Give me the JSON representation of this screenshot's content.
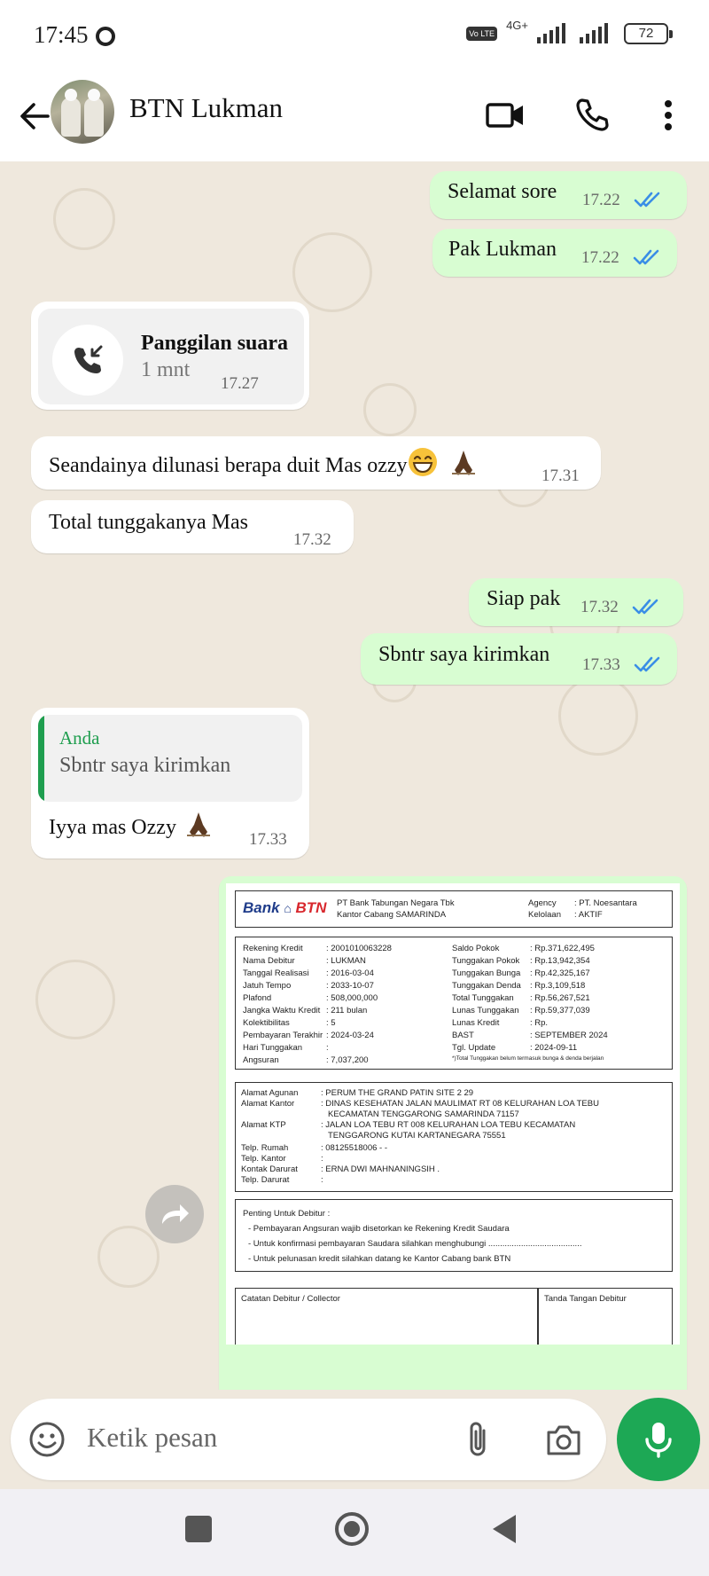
{
  "status_bar": {
    "time": "17:45",
    "network": "4G+",
    "volte": "Vo LTE",
    "battery": "72"
  },
  "header": {
    "contact_name": "BTN Lukman"
  },
  "messages": [
    {
      "id": "m1",
      "direction": "out",
      "text": "Selamat sore",
      "time": "17.22",
      "read": true
    },
    {
      "id": "m2",
      "direction": "out",
      "text": "Pak Lukman",
      "time": "17.22",
      "read": true
    },
    {
      "id": "m3",
      "direction": "in",
      "type": "call",
      "title": "Panggilan suara",
      "duration": "1 mnt",
      "time": "17.27"
    },
    {
      "id": "m4",
      "direction": "in",
      "text": "Seandainya dilunasi berapa duit Mas ozzy",
      "emojis": [
        "grinning-face",
        "folded-hands"
      ],
      "time": "17.31"
    },
    {
      "id": "m5",
      "direction": "in",
      "text": "Total tunggakanya Mas",
      "time": "17.32"
    },
    {
      "id": "m6",
      "direction": "out",
      "text": "Siap pak",
      "time": "17.32",
      "read": true
    },
    {
      "id": "m7",
      "direction": "out",
      "text": "Sbntr saya kirimkan",
      "time": "17.33",
      "read": true
    },
    {
      "id": "m8",
      "direction": "in",
      "quote_author": "Anda",
      "quote_text": "Sbntr saya kirimkan",
      "text": "Iyya mas Ozzy",
      "emojis": [
        "folded-hands"
      ],
      "time": "17.33"
    }
  ],
  "document": {
    "logo_text": "Bank",
    "logo_brand": "BTN",
    "bank_name": "PT Bank Tabungan Negara Tbk",
    "branch": "Kantor Cabang SAMARINDA",
    "agency_label": "Agency",
    "agency_value": ": PT. Noesantara",
    "kelolaan_label": "Kelolaan",
    "kelolaan_value": ": AKTIF",
    "left_fields": [
      {
        "label": "Rekening Kredit",
        "value": ": 2001010063228"
      },
      {
        "label": "Nama Debitur",
        "value": ": LUKMAN"
      },
      {
        "label": "Tanggal Realisasi",
        "value": ": 2016-03-04"
      },
      {
        "label": "Jatuh Tempo",
        "value": ": 2033-10-07"
      },
      {
        "label": "Plafond",
        "value": ": 508,000,000"
      },
      {
        "label": "Jangka Waktu Kredit",
        "value": ": 211 bulan"
      },
      {
        "label": "Kolektibilitas",
        "value": ": 5"
      },
      {
        "label": "Pembayaran Terakhir",
        "value": ": 2024-03-24"
      },
      {
        "label": "Hari Tunggakan",
        "value": ":"
      },
      {
        "label": "Angsuran",
        "value": ": 7,037,200"
      }
    ],
    "right_fields": [
      {
        "label": "Saldo Pokok",
        "value": ": Rp.371,622,495"
      },
      {
        "label": "Tunggakan Pokok",
        "value": ": Rp.13,942,354"
      },
      {
        "label": "Tunggakan Bunga",
        "value": ": Rp.42,325,167"
      },
      {
        "label": "Tunggakan Denda",
        "value": ": Rp.3,109,518"
      },
      {
        "label": "Total Tunggakan",
        "value": ": Rp.56,267,521"
      },
      {
        "label": "Lunas Tunggakan",
        "value": ": Rp.59,377,039"
      },
      {
        "label": "Lunas Kredit",
        "value": ": Rp."
      },
      {
        "label": "BAST",
        "value": ": SEPTEMBER 2024"
      },
      {
        "label": "Tgl. Update",
        "value": ": 2024-09-11"
      }
    ],
    "footnote": "*)Total Tunggakan belum termasuk bunga & denda berjalan",
    "addr_fields": [
      {
        "label": "Alamat Agunan",
        "value": ": PERUM THE GRAND PATIN SITE 2 29"
      },
      {
        "label": "Alamat Kantor",
        "value": ":  DINAS KESEHATAN JALAN MAULIMAT RT 08 KELURAHAN LOA TEBU"
      },
      {
        "label": "",
        "value": "KECAMATAN TENGGARONG SAMARINDA 71157"
      },
      {
        "label": "Alamat KTP",
        "value": ": JALAN LOA TEBU RT 008 KELURAHAN LOA TEBU KECAMATAN"
      },
      {
        "label": "",
        "value": "TENGGARONG KUTAI KARTANEGARA 75551"
      },
      {
        "label": "Telp. Rumah",
        "value": ":  08125518006 - -"
      },
      {
        "label": "Telp. Kantor",
        "value": ":"
      },
      {
        "label": "Kontak Darurat",
        "value": ":  ERNA DWI MAHNANINGSIH ."
      },
      {
        "label": "Telp. Darurat",
        "value": ":"
      }
    ],
    "notes_title": "Penting Untuk Debitur :",
    "notes": [
      "- Pembayaran Angsuran wajib disetorkan ke Rekening Kredit Saudara",
      "- Untuk konfirmasi pembayaran Saudara silahkan menghubungi ........................................",
      "- Untuk pelunasan kredit silahkan datang ke Kantor Cabang bank BTN"
    ],
    "collector_label": "Catatan Debitur / Collector",
    "signature_label": "Tanda Tangan Debitur"
  },
  "input": {
    "placeholder": "Ketik pesan"
  },
  "colors": {
    "outgoing_bubble": "#d8fdd2",
    "incoming_bubble": "#ffffff",
    "chat_background": "#efe8dd",
    "accent_green": "#1da855",
    "read_tick": "#3a8ee6"
  }
}
